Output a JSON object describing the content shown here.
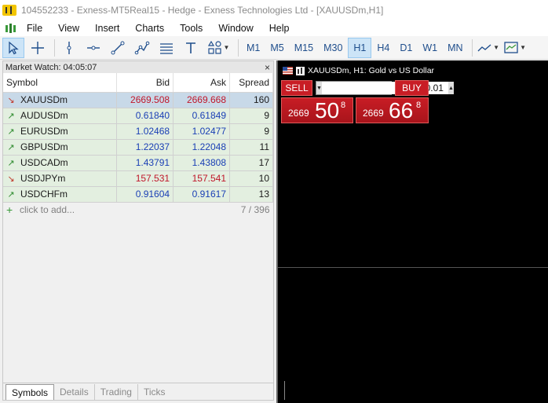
{
  "window": {
    "title": "104552233 - Exness-MT5Real15 - Hedge - Exness Technologies Ltd - [XAUUSDm,H1]"
  },
  "menu": {
    "items": [
      "File",
      "View",
      "Insert",
      "Charts",
      "Tools",
      "Window",
      "Help"
    ]
  },
  "toolbar": {
    "tools": [
      "cursor-icon",
      "crosshair-icon",
      "vertical-line-icon",
      "horizontal-line-icon",
      "trend-line-icon",
      "polyline-icon",
      "channel-icon",
      "text-icon",
      "shapes-icon"
    ],
    "timeframes": [
      "M1",
      "M5",
      "M15",
      "M30",
      "H1",
      "H4",
      "D1",
      "W1",
      "MN"
    ],
    "active_timeframe": "H1"
  },
  "market_watch": {
    "title": "Market Watch: 04:05:07",
    "close": "×",
    "columns": {
      "symbol": "Symbol",
      "bid": "Bid",
      "ask": "Ask",
      "spread": "Spread"
    },
    "rows": [
      {
        "symbol": "XAUUSDm",
        "bid": "2669.508",
        "ask": "2669.668",
        "spread": "160",
        "direction": "down",
        "selected": true
      },
      {
        "symbol": "AUDUSDm",
        "bid": "0.61840",
        "ask": "0.61849",
        "spread": "9",
        "direction": "up",
        "selected": false
      },
      {
        "symbol": "EURUSDm",
        "bid": "1.02468",
        "ask": "1.02477",
        "spread": "9",
        "direction": "up",
        "selected": false
      },
      {
        "symbol": "GBPUSDm",
        "bid": "1.22037",
        "ask": "1.22048",
        "spread": "11",
        "direction": "up",
        "selected": false
      },
      {
        "symbol": "USDCADm",
        "bid": "1.43791",
        "ask": "1.43808",
        "spread": "17",
        "direction": "up",
        "selected": false
      },
      {
        "symbol": "USDJPYm",
        "bid": "157.531",
        "ask": "157.541",
        "spread": "10",
        "direction": "down",
        "selected": false
      },
      {
        "symbol": "USDCHFm",
        "bid": "0.91604",
        "ask": "0.91617",
        "spread": "13",
        "direction": "up",
        "selected": false
      }
    ],
    "add_label": "click to add...",
    "count": "7 / 396",
    "tabs": [
      "Symbols",
      "Details",
      "Trading",
      "Ticks"
    ],
    "active_tab": "Symbols"
  },
  "chart": {
    "title": "XAUUSDm, H1:  Gold vs US Dollar",
    "sell_label": "SELL",
    "buy_label": "BUY",
    "lot": "0.01",
    "sell_price": {
      "prefix": "2669",
      "big": "50",
      "sup": "8"
    },
    "buy_price": {
      "prefix": "2669",
      "big": "66",
      "sup": "8"
    }
  },
  "colors": {
    "price_up": "#1a3fb5",
    "price_down": "#c0162a",
    "trade_red": "#c81d25",
    "row_green": "#e3efe0",
    "row_selected": "#c8d9e8"
  }
}
